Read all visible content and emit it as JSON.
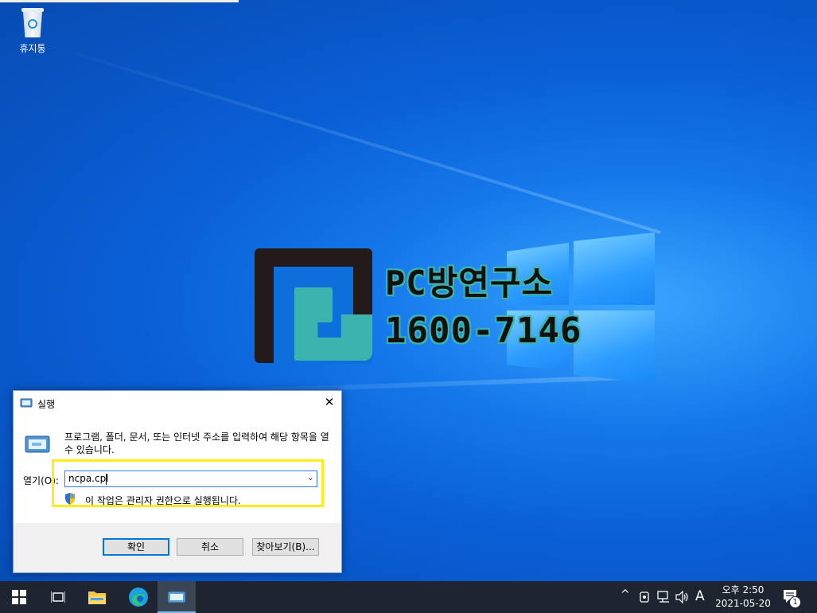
{
  "desktop": {
    "recycle_bin_label": "휴지통"
  },
  "watermark": {
    "brand": "PC방연구소",
    "phone": "1600-7146"
  },
  "run_dialog": {
    "title": "실행",
    "close_glyph": "✕",
    "description": "프로그램, 폴더, 문서, 또는 인터넷 주소를 입력하여 해당 항목을 열 수 있습니다.",
    "open_label": "열기(O):",
    "input_value": "ncpa.cpl",
    "admin_note": "이 작업은 관리자 권한으로 실행됩니다.",
    "ok_button": "확인",
    "cancel_button": "취소",
    "browse_button": "찾아보기(B)..."
  },
  "taskbar": {
    "items": [
      "start-icon",
      "task-view-icon",
      "file-explorer-icon",
      "edge-icon",
      "run-icon"
    ],
    "tray": {
      "chevron": "^",
      "ime_indicator": "A"
    },
    "clock": {
      "time": "오후 2:50",
      "date": "2021-05-20"
    },
    "notification_count": "1"
  },
  "colors": {
    "desktop_blue": "#0a5fd6",
    "highlight_yellow": "#ffec1a",
    "watermark_teal": "#3cb4ad",
    "taskbar": "#1e2530"
  }
}
